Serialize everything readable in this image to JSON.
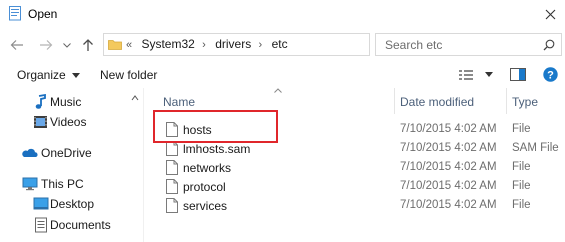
{
  "window": {
    "title": "Open",
    "close_icon": "close-icon"
  },
  "address_bar": {
    "overflow": "«",
    "segments": [
      "System32",
      "drivers",
      "etc"
    ]
  },
  "search": {
    "placeholder": "Search etc"
  },
  "toolbar": {
    "organize_label": "Organize",
    "new_folder_label": "New folder"
  },
  "navigation": {
    "items": [
      {
        "label": "Music",
        "icon": "music-icon"
      },
      {
        "label": "Videos",
        "icon": "videos-icon"
      },
      {
        "label": "OneDrive",
        "icon": "onedrive-icon"
      },
      {
        "label": "This PC",
        "icon": "this-pc-icon"
      },
      {
        "label": "Desktop",
        "icon": "desktop-icon"
      },
      {
        "label": "Documents",
        "icon": "documents-icon"
      }
    ]
  },
  "file_list": {
    "columns": [
      "Name",
      "Date modified",
      "Type"
    ],
    "rows": [
      {
        "name": "hosts",
        "date": "7/10/2015 4:02 AM",
        "type": "File"
      },
      {
        "name": "lmhosts.sam",
        "date": "7/10/2015 4:02 AM",
        "type": "SAM File"
      },
      {
        "name": "networks",
        "date": "7/10/2015 4:02 AM",
        "type": "File"
      },
      {
        "name": "protocol",
        "date": "7/10/2015 4:02 AM",
        "type": "File"
      },
      {
        "name": "services",
        "date": "7/10/2015 4:02 AM",
        "type": "File"
      }
    ]
  },
  "colors": {
    "highlight": "#e0262b",
    "header_text": "#4c607a",
    "accent_blue": "#1979ca",
    "folder_yellow": "#f4c95d"
  }
}
